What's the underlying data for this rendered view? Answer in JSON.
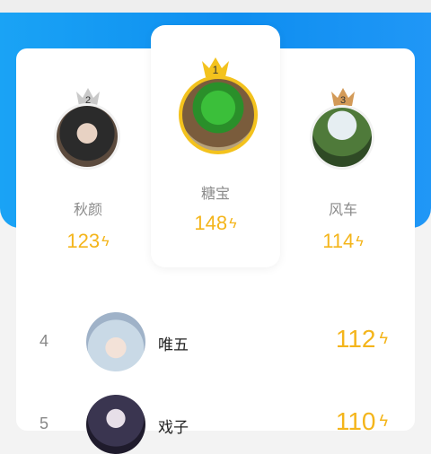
{
  "podium": [
    {
      "rank_badge": "2",
      "name": "秋颜",
      "score": "123",
      "bolt": "ϟ",
      "crown_icon": "silver-crown-icon",
      "crown_color": "#c9c9c9"
    },
    {
      "rank_badge": "1",
      "name": "糖宝",
      "score": "148",
      "bolt": "ϟ",
      "crown_icon": "gold-crown-icon",
      "crown_color": "#f3c21d"
    },
    {
      "rank_badge": "3",
      "name": "风车",
      "score": "114",
      "bolt": "ϟ",
      "crown_icon": "bronze-crown-icon",
      "crown_color": "#d39a58"
    }
  ],
  "list": [
    {
      "rank": "4",
      "name": "唯五",
      "score": "112",
      "bolt": "ϟ"
    },
    {
      "rank": "5",
      "name": "戏子",
      "score": "110",
      "bolt": "ϟ"
    }
  ],
  "colors": {
    "banner": "#1197f2",
    "score": "#f4b51b",
    "gold": "#f3c21d"
  }
}
